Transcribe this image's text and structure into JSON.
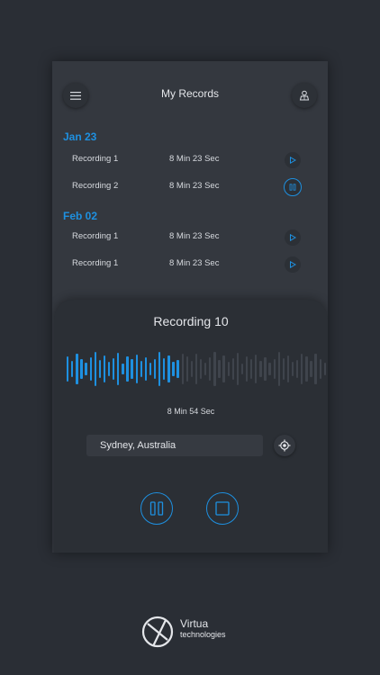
{
  "header": {
    "title": "My Records",
    "menu_icon": "menu-icon",
    "profile_icon": "user-profile-icon"
  },
  "groups": [
    {
      "date": "Jan 23",
      "items": [
        {
          "name": "Recording 1",
          "duration": "8 Min 23 Sec",
          "action": "play"
        },
        {
          "name": "Recording 2",
          "duration": "8 Min 23 Sec",
          "action": "pause"
        }
      ]
    },
    {
      "date": "Feb 02",
      "items": [
        {
          "name": "Recording 1",
          "duration": "8 Min 23 Sec",
          "action": "play"
        },
        {
          "name": "Recording 1",
          "duration": "8 Min 23 Sec",
          "action": "play"
        }
      ]
    }
  ],
  "player": {
    "title": "Recording 10",
    "elapsed": "8 Min 54 Sec",
    "location": "Sydney, Australia",
    "location_icon": "gps-target-icon",
    "controls": [
      "pause-icon",
      "stop-icon"
    ]
  },
  "brand": {
    "line1": "Virtua",
    "line2": "technologies"
  },
  "colors": {
    "accent": "#1e90e0",
    "background": "#2a2e35",
    "card": "#34383f",
    "wave_inactive": "#3f444c"
  }
}
